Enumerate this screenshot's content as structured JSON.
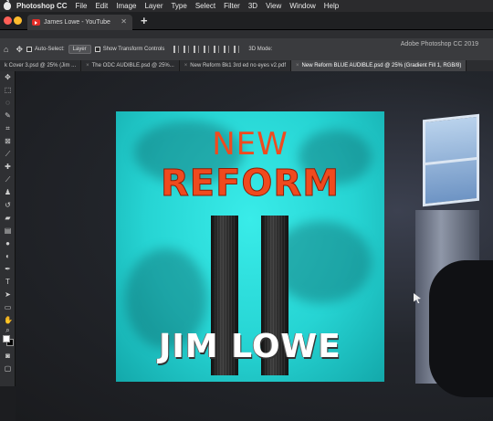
{
  "menubar": {
    "app_name": "Photoshop CC",
    "items": [
      "File",
      "Edit",
      "Image",
      "Layer",
      "Type",
      "Select",
      "Filter",
      "3D",
      "View",
      "Window",
      "Help"
    ]
  },
  "browser": {
    "tab_title": "James Lowe - YouTube",
    "close_glyph": "✕",
    "new_tab_glyph": "+"
  },
  "options_bar": {
    "auto_select_label": "Auto-Select:",
    "auto_select_value": "Layer",
    "show_transform_label": "Show Transform Controls",
    "mode_label": "3D Mode:",
    "app_title": "Adobe Photoshop CC 2019"
  },
  "doc_tabs": [
    {
      "label": "k Cover 3.psd @ 25% (Jim ...",
      "active": false
    },
    {
      "label": "The ODC AUDIBLE.psd @ 25%...",
      "active": false
    },
    {
      "label": "New Reform Bk1 3rd ed no eyes v2.pdf",
      "active": false
    },
    {
      "label": "New Reform BLUE AUDIBLE.psd @ 25% (Gradient Fill 1, RGB/8)",
      "active": true
    }
  ],
  "cover": {
    "line1": "NEW",
    "line2": "REFORM",
    "author": "JIM LOWE",
    "colors": {
      "background": "#26d4d3",
      "title": "#f04a1e",
      "author": "#ffffff"
    }
  },
  "icons": {
    "traffic_lights": [
      "#ff5f57",
      "#febc2e",
      "#28c840"
    ]
  }
}
